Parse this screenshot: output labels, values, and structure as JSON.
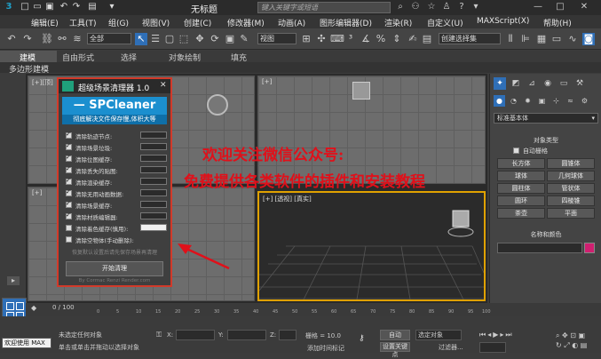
{
  "window": {
    "title": "无标题",
    "search_placeholder": "键入关键字或短语"
  },
  "menu": [
    "编辑(E)",
    "工具(T)",
    "组(G)",
    "视图(V)",
    "创建(C)",
    "修改器(M)",
    "动画(A)",
    "图形编辑器(D)",
    "渲染(R)",
    "自定义(U)",
    "MAXScript(X)",
    "帮助(H)"
  ],
  "toolbar": {
    "filter_select": "全部",
    "view_select": "视图",
    "selection_set": "创建选择集"
  },
  "ribbon": {
    "tabs": [
      "建模",
      "自由形式",
      "选择",
      "对象绘制",
      "填充"
    ],
    "subpanel": "多边形建模"
  },
  "viewports": {
    "top_left": "[+][顶]",
    "top_right": "[+]",
    "bottom_left": "[+]",
    "perspective": "[+] [透视] [真实]"
  },
  "plugin": {
    "title": "超级场景清理器 1.0",
    "banner": "— SPCleaner",
    "subtitle": "彻底解决文件保存慢,体积大等",
    "options": [
      {
        "label": "清除轨迹节点:",
        "checked": true,
        "box": "dark"
      },
      {
        "label": "清除场景垃圾:",
        "checked": true,
        "box": "dark"
      },
      {
        "label": "清除位图缓存:",
        "checked": true,
        "box": "dark"
      },
      {
        "label": "清除丢失的贴图:",
        "checked": true,
        "box": "dark"
      },
      {
        "label": "清除渲染缓存:",
        "checked": true,
        "box": "dark"
      },
      {
        "label": "清除无用动画数据:",
        "checked": true,
        "box": "dark"
      },
      {
        "label": "清除场景缓存:",
        "checked": true,
        "box": "dark"
      },
      {
        "label": "清除材质编辑器:",
        "checked": true,
        "box": "dark"
      },
      {
        "label": "清除着色缓存(慎用):",
        "checked": false,
        "box": "white"
      },
      {
        "label": "清除空物体(手动删除):",
        "checked": false,
        "box": "none"
      }
    ],
    "hint": "恢复默认设置后请先保存场景再清理",
    "start_button": "开始清理",
    "footer": "By Cormac Renzi Render.com"
  },
  "overlay": {
    "line1": "欢迎关注微信公众号:",
    "line2": "免费提供各类软件的插件和安装教程"
  },
  "command_panel": {
    "category_select": "标准基本体",
    "object_type_title": "对象类型",
    "auto_grid": "自动栅格",
    "buttons": [
      "长方体",
      "圆锥体",
      "球体",
      "几何球体",
      "圆柱体",
      "管状体",
      "圆环",
      "四棱锥",
      "茶壶",
      "平面"
    ],
    "name_color_title": "名称和颜色"
  },
  "timeline": {
    "frame_range": "0 / 100",
    "ticks": [
      "0",
      "5",
      "10",
      "15",
      "20",
      "25",
      "30",
      "35",
      "40",
      "45",
      "50",
      "55",
      "60",
      "65",
      "70",
      "75",
      "80",
      "85",
      "90",
      "95",
      "100"
    ]
  },
  "status": {
    "script_label": "欢迎使用 MAX",
    "prompt1": "未选定任何对象",
    "prompt2": "单击或单击并拖动以选择对象",
    "grid": "栅格 = 10.0",
    "add_time_tag": "添加时间标记",
    "auto_key": "自动",
    "set_key": "设置关键点",
    "selected_object": "选定对象",
    "filters": "过滤器...",
    "x_label": "X:",
    "y_label": "Y:",
    "z_label": "Z:"
  },
  "colors": {
    "accent_blue": "#1b8fcf",
    "plugin_border": "#d23a2a",
    "overlay_red": "#e0101a",
    "viewport_active": "#e0a100"
  }
}
